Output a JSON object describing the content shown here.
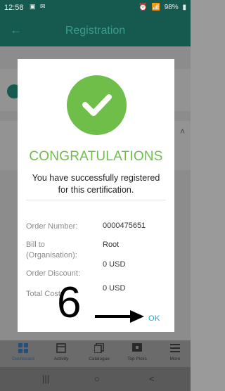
{
  "status_bar": {
    "time": "12:58",
    "left_icons": "▣ ✉",
    "right_icons": [
      "⏰",
      "📶",
      "98%",
      "▮"
    ]
  },
  "app_bar": {
    "back_icon": "arrow-back-icon",
    "title": "Registration"
  },
  "dialog": {
    "title": "CONGRATULATIONS",
    "message": "You have successfully registered for this certification.",
    "rows": [
      {
        "label": "Order Number:",
        "value": "0000475651"
      },
      {
        "label": "Bill to (Organisation):",
        "value": "Root"
      },
      {
        "label": "Order Discount:",
        "value": "0 USD"
      },
      {
        "label": "Total Cost:",
        "value": "0 USD"
      }
    ],
    "ok_label": "OK"
  },
  "annotation": {
    "number": "6"
  },
  "colors": {
    "success_green": "#6fbe4a",
    "ok_blue": "#1aa7d6",
    "app_bar_teal": "#16594f"
  },
  "bottom_nav": {
    "items": [
      {
        "label": "Dashboard",
        "icon": "dashboard-icon"
      },
      {
        "label": "Activity",
        "icon": "activity-icon"
      },
      {
        "label": "Catalogue",
        "icon": "catalogue-icon"
      },
      {
        "label": "Top Picks",
        "icon": "top-picks-icon"
      },
      {
        "label": "More",
        "icon": "menu-icon"
      }
    ]
  },
  "android_nav": {
    "recents": "|||",
    "home": "○",
    "back": "<"
  }
}
